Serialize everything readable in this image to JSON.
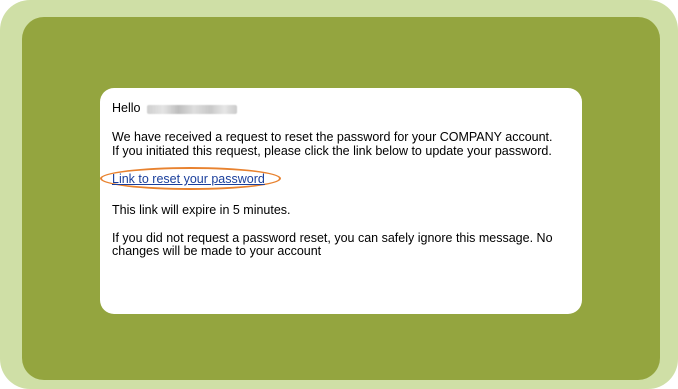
{
  "email": {
    "greeting": "Hello",
    "request_text": "We have received a request to reset the password for your COMPANY account. If you initiated this request, please click the link below to update your password.",
    "reset_link_label": "Link to reset your password",
    "expiry_text": "This link will expire in 5 minutes.",
    "ignore_text": "If you did not request a password reset, you can safely ignore this message. No changes will be made to your account"
  },
  "colors": {
    "outer_frame": "#cfdfa6",
    "panel": "#94a53f",
    "card": "#ffffff",
    "link": "#1a3f9c",
    "highlight": "#e8822f"
  }
}
